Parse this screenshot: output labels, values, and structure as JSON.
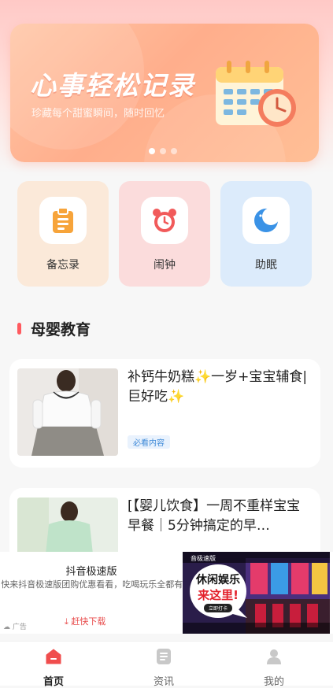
{
  "banner": {
    "title": "心事轻松记录",
    "subtitle": "珍藏每个甜蜜瞬间，随时回忆",
    "page_count": 3,
    "active_page": 1
  },
  "tools": [
    {
      "label": "备忘录",
      "icon": "clipboard-icon",
      "bg": "#fbe9d9",
      "accent": "#f7a43a"
    },
    {
      "label": "闹钟",
      "icon": "alarm-clock-icon",
      "bg": "#fbdcdc",
      "accent": "#f15a5a"
    },
    {
      "label": "助眠",
      "icon": "moon-icon",
      "bg": "#dcebfb",
      "accent": "#3a92e6"
    }
  ],
  "section": {
    "title": "母婴教育",
    "accent": "#ff5a5f"
  },
  "articles": [
    {
      "title": "补钙牛奶糕✨一岁+宝宝辅食|巨好吃✨",
      "tag": "必看内容"
    },
    {
      "title": "[【婴儿饮食】一周不重样宝宝早餐｜5分钟搞定的早…",
      "tag": ""
    }
  ],
  "ad": {
    "title": "抖音极速版",
    "description": "快来抖音极速版团购优惠看看，吃喝玩乐全都有!",
    "download": "赶快下载",
    "mark": "广告",
    "image_headline_1": "休闲娱乐",
    "image_headline_2": "来这里!",
    "image_button": "立即打卡",
    "image_brand": "音极速版"
  },
  "tabbar": [
    {
      "label": "首页",
      "icon": "home-icon",
      "active": true
    },
    {
      "label": "资讯",
      "icon": "news-icon",
      "active": false
    },
    {
      "label": "我的",
      "icon": "user-icon",
      "active": false
    }
  ]
}
